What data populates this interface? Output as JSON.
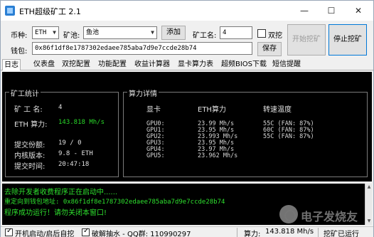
{
  "window": {
    "title": "ETH超级矿工 2.1"
  },
  "controls": {
    "minimize": "—",
    "maximize": "☐",
    "close": "✕"
  },
  "form": {
    "currency_label": "币种:",
    "currency_value": "ETH",
    "pool_label": "矿池:",
    "pool_value": "鱼池",
    "add_button": "添加",
    "worker_label": "矿工名:",
    "worker_value": "4",
    "dual_label": "双挖",
    "dual_checked": false,
    "wallet_label": "钱包:",
    "wallet_value": "0x86f1df8e1787302edaee785aba7d9e7ccde28b74",
    "save_button": "保存",
    "start_button": "开始挖矿",
    "stop_button": "停止挖矿"
  },
  "tabs": [
    "日志",
    "仪表盘",
    "双挖配置",
    "功能配置",
    "收益计算器",
    "显卡算力表",
    "超频BIOS下载",
    "短信提醒"
  ],
  "mining_stats": {
    "title": "矿工统计",
    "rows": [
      {
        "label": "矿 工 名:",
        "value": "4",
        "highlight": false
      },
      {
        "label": "ETH 算力:",
        "value": "143.818 Mh/s",
        "highlight": true
      },
      {
        "label": "提交份额:",
        "value": "19  /  0",
        "highlight": false
      },
      {
        "label": "内核版本:",
        "value": "9.8 - ETH",
        "highlight": false
      },
      {
        "label": "提交时间:",
        "value": "20:47:18",
        "highlight": false
      }
    ]
  },
  "hashrate_detail": {
    "title": "算力详情",
    "headers": [
      "显卡",
      "ETH算力",
      "转速温度"
    ],
    "gpus": [
      {
        "name": "GPU0:",
        "hashrate": "23.99 Mh/s",
        "temp": "55C (FAN: 87%)"
      },
      {
        "name": "GPU1:",
        "hashrate": "23.95 Mh/s",
        "temp": "60C (FAN: 87%)"
      },
      {
        "name": "GPU2:",
        "hashrate": "23.993 Mh/s",
        "temp": "55C (FAN: 87%)"
      },
      {
        "name": "GPU3:",
        "hashrate": "23.95 Mh/s",
        "temp": ""
      },
      {
        "name": "GPU4:",
        "hashrate": "23.97 Mh/s",
        "temp": ""
      },
      {
        "name": "GPU5:",
        "hashrate": "23.962 Mh/s",
        "temp": ""
      }
    ]
  },
  "log": {
    "lines": [
      "去除开发者收费程序正在启动中......",
      "重定向到钱包地址: 0x86f1df8e1787302edaee785aba7d9e7ccde28b74",
      "程序成功运行！请勿关闭本窗口!"
    ]
  },
  "statusbar": {
    "autostart_label": "开机启动/启后自挖",
    "autostart_checked": true,
    "crack_label": "破解抽水 - QQ群: 110990297",
    "crack_checked": true,
    "hashrate_label": "算力:",
    "hashrate_value": "143.818 Mh/s",
    "state_label": "挖矿已运行"
  },
  "watermark": {
    "text": "电子发烧友"
  },
  "colors": {
    "log_text": "#2ee02e",
    "highlight_value": "#29d829",
    "panel_bg": "#000000"
  }
}
